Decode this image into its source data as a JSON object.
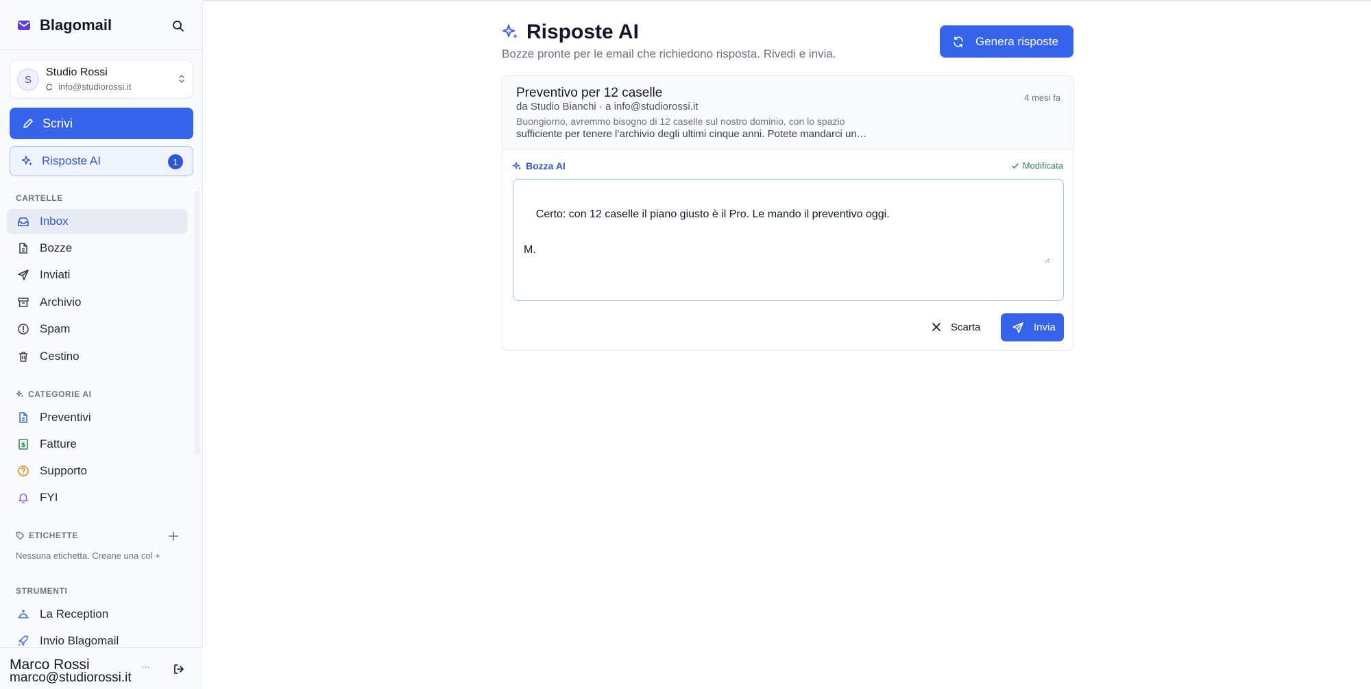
{
  "app": {
    "name": "Blagomail"
  },
  "account": {
    "avatar_letter": "S",
    "name": "Studio Rossi",
    "email": "info@studiorossi.it"
  },
  "compose_label": "Scrivi",
  "ai_replies": {
    "label": "Risposte AI",
    "count": "1"
  },
  "folders": {
    "title": "CARTELLE",
    "items": [
      {
        "label": "Inbox",
        "icon": "inbox-icon"
      },
      {
        "label": "Bozze",
        "icon": "file-icon"
      },
      {
        "label": "Inviati",
        "icon": "send-icon"
      },
      {
        "label": "Archivio",
        "icon": "archive-icon"
      },
      {
        "label": "Spam",
        "icon": "alert-circle-icon"
      },
      {
        "label": "Cestino",
        "icon": "trash-icon"
      }
    ]
  },
  "ai_categories": {
    "title": "CATEGORIE AI",
    "items": [
      {
        "label": "Preventivi",
        "icon": "document-icon",
        "color": "#3b6be8"
      },
      {
        "label": "Fatture",
        "icon": "dollar-icon",
        "color": "#2f8a5a"
      },
      {
        "label": "Supporto",
        "icon": "help-circle-icon",
        "color": "#e08a1e"
      },
      {
        "label": "FYI",
        "icon": "bell-icon",
        "color": "#8b5cf6"
      }
    ]
  },
  "labels": {
    "title": "ETICHETTE",
    "empty_text": "Nessuna etichetta. Creane una col +"
  },
  "tools": {
    "title": "STRUMENTI",
    "items": [
      {
        "label": "La Reception",
        "icon": "bell-desk-icon"
      },
      {
        "label": "Invio Blagomail",
        "icon": "rocket-icon"
      }
    ]
  },
  "user": {
    "name": "Marco Rossi",
    "email": "marco@studiorossi.it",
    "more": "···"
  },
  "page": {
    "title": "Risposte AI",
    "subtitle": "Bozze pronte per le email che richiedono risposta. Rivedi e invia.",
    "generate_label": "Genera risposte"
  },
  "email": {
    "subject": "Preventivo per 12 caselle",
    "from_line": "da Studio Bianchi · a info@studiorossi.it",
    "time": "4 mesi fa",
    "preview_line1": "Buongiorno, avremmo bisogno di 12 caselle sul nostro dominio, con lo spazio",
    "preview_line2": "sufficiente per tenere l’archivio degli ultimi cinque anni. Potete mandarci un…"
  },
  "draft": {
    "label": "Bozza AI",
    "status": "Modificata",
    "text": "Certo: con 12 caselle il piano giusto è il Pro. Le mando il preventivo oggi.\n\nM.",
    "discard_label": "Scarta",
    "send_label": "Invia"
  },
  "colors": {
    "accent": "#3563e9",
    "success": "#2f8a5a"
  }
}
